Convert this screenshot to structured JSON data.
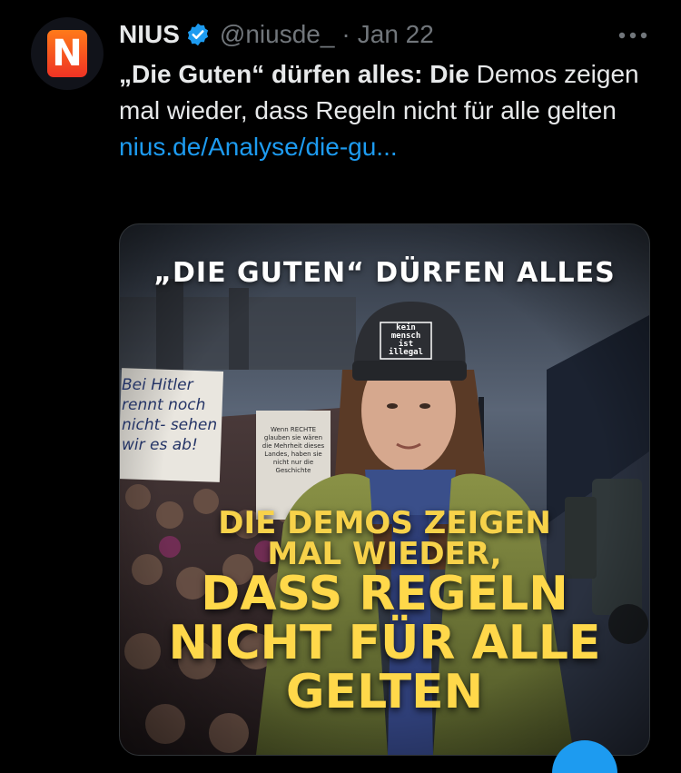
{
  "tweet": {
    "display_name": "NIUS",
    "handle": "@niusde_",
    "separator": "·",
    "date": "Jan 22",
    "more_label": "•••",
    "avatar_letter": "N",
    "text_bold_1": "„Die Guten“ dürfen alles: Die",
    "text_rest": " Demos zeigen mal wieder, dass Regeln nicht für alle gelten",
    "link": "nius.de/Analyse/die-gu..."
  },
  "media": {
    "title": "„DIE GUTEN“ DÜRFEN ALLES",
    "caption_small_1": "DIE DEMOS ZEIGEN",
    "caption_small_2": "MAL WIEDER,",
    "caption_big_1": "DASS REGELN",
    "caption_big_2": "NICHT FÜR ALLE",
    "caption_big_3": "GELTEN",
    "sign_left": "Bei Hitler rennt noch nicht- sehen wir es ab!",
    "sign_right": "Wenn RECHTE glauben sie wären die Mehrheit dieses Landes, haben sie nicht nur die Geschichte",
    "beanie": "kein mensch ist illegal"
  },
  "colors": {
    "background": "#000000",
    "text": "#e7e9ea",
    "muted": "#71767b",
    "link": "#1d9bf0",
    "verified": "#1d9bf0",
    "caption_yellow": "#ffd84a"
  }
}
